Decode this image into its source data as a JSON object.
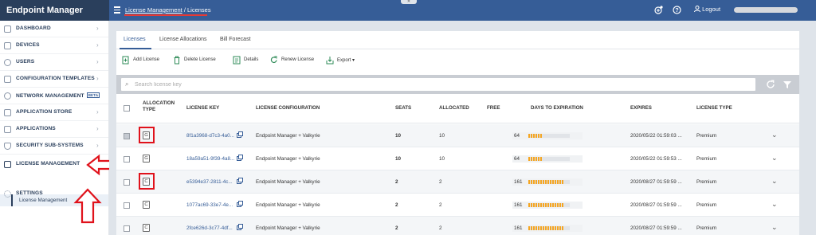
{
  "app": {
    "title": "Endpoint Manager"
  },
  "header": {
    "breadcrumb_link": "License Management",
    "breadcrumb_sep": "/",
    "breadcrumb_current": "Licenses",
    "logout_label": "Logout",
    "icons": [
      "add-icon",
      "help-icon",
      "user-icon"
    ]
  },
  "sidebar": {
    "items": [
      {
        "label": "DASHBOARD",
        "icon": "dashboard-icon"
      },
      {
        "label": "DEVICES",
        "icon": "devices-icon"
      },
      {
        "label": "USERS",
        "icon": "users-icon"
      },
      {
        "label": "CONFIGURATION TEMPLATES",
        "icon": "templates-icon"
      },
      {
        "label": "NETWORK MANAGEMENT",
        "icon": "network-icon",
        "badge": "BETA"
      },
      {
        "label": "APPLICATION STORE",
        "icon": "store-icon"
      },
      {
        "label": "APPLICATIONS",
        "icon": "applications-icon"
      },
      {
        "label": "SECURITY SUB-SYSTEMS",
        "icon": "shield-icon"
      },
      {
        "label": "LICENSE MANAGEMENT",
        "icon": "license-icon"
      },
      {
        "label": "SETTINGS",
        "icon": "gear-icon"
      }
    ],
    "sub_item": "License Management"
  },
  "tabs": [
    {
      "label": "Licenses",
      "active": true
    },
    {
      "label": "License Allocations",
      "active": false
    },
    {
      "label": "Bill Forecast",
      "active": false
    }
  ],
  "toolbar": {
    "add": "Add License",
    "delete": "Delete License",
    "details": "Details",
    "renew": "Renew License",
    "export": "Export"
  },
  "search": {
    "placeholder": "Search license key"
  },
  "table": {
    "headers": {
      "allocation_type_1": "ALLOCATION",
      "allocation_type_2": "TYPE",
      "license_key": "LICENSE KEY",
      "license_configuration": "LICENSE CONFIGURATION",
      "seats": "SEATS",
      "allocated": "ALLOCATED",
      "free": "FREE",
      "days_to_expiration": "DAYS TO EXPIRATION",
      "expires": "EXPIRES",
      "license_type": "LICENSE TYPE"
    },
    "rows": [
      {
        "alloc": "G",
        "key": "8f1a3968-d7c3-4a0...",
        "config": "Endpoint Manager + Valkyrie",
        "seats": "10",
        "allocated": "10",
        "free": "",
        "days": "64",
        "days_fraction": 0.35,
        "expires": "2020/05/22 01:59:03 ...",
        "type": "Premium"
      },
      {
        "alloc": "G",
        "key": "18a59a51-9f39-4a8...",
        "config": "Endpoint Manager + Valkyrie",
        "seats": "10",
        "allocated": "10",
        "free": "",
        "days": "64",
        "days_fraction": 0.35,
        "expires": "2020/05/22 01:59:53 ...",
        "type": "Premium"
      },
      {
        "alloc": "C",
        "key": "e5394e37-2811-4c...",
        "config": "Endpoint Manager + Valkyrie",
        "seats": "2",
        "allocated": "2",
        "free": "",
        "days": "161",
        "days_fraction": 0.85,
        "expires": "2020/08/27 01:59:59 ...",
        "type": "Premium"
      },
      {
        "alloc": "C",
        "key": "1077ac69-33e7-4e...",
        "config": "Endpoint Manager + Valkyrie",
        "seats": "2",
        "allocated": "2",
        "free": "",
        "days": "161",
        "days_fraction": 0.85,
        "expires": "2020/08/27 01:59:59 ...",
        "type": "Premium"
      },
      {
        "alloc": "C",
        "key": "2fce626d-3c77-4df...",
        "config": "Endpoint Manager + Valkyrie",
        "seats": "2",
        "allocated": "2",
        "free": "",
        "days": "161",
        "days_fraction": 0.85,
        "expires": "2020/08/27 01:59:59 ...",
        "type": "Premium"
      }
    ]
  },
  "colors": {
    "header": "#365d97",
    "brand": "#2a3f5c",
    "accent": "#365d97",
    "highlight": "#e0121b",
    "expiry_bar": "#f5a623"
  }
}
